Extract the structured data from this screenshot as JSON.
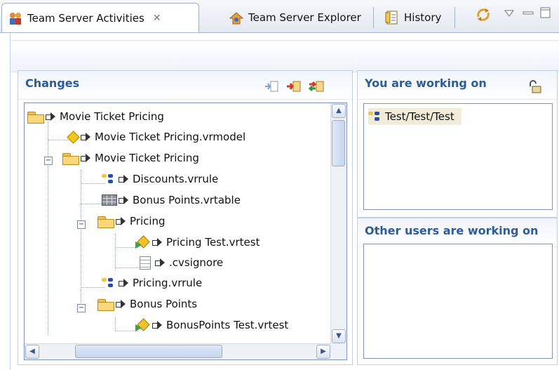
{
  "tabs": [
    {
      "label": "Team Server Activities",
      "close": "✕",
      "icon": "team-activities-icon"
    },
    {
      "label": "Team Server Explorer",
      "icon": "team-explorer-icon"
    },
    {
      "label": "History",
      "icon": "history-icon"
    }
  ],
  "toolbar_icons": [
    "sync-icon",
    "view-menu-icon",
    "minimize-icon",
    "maximize-icon"
  ],
  "changes": {
    "title": "Changes",
    "actions": [
      "incoming-icon",
      "outgoing-icon",
      "conflict-icon"
    ],
    "tree": [
      {
        "label": "Movie Ticket Pricing",
        "icon": "folder-icon"
      },
      {
        "label": "Movie Ticket Pricing.vrmodel",
        "icon": "model-icon"
      },
      {
        "label": "Movie Ticket Pricing",
        "icon": "folder-icon"
      },
      {
        "label": "Discounts.vrrule",
        "icon": "rule-icon"
      },
      {
        "label": "Bonus Points.vrtable",
        "icon": "table-icon"
      },
      {
        "label": "Pricing",
        "icon": "folder-icon"
      },
      {
        "label": "Pricing Test.vrtest",
        "icon": "test-icon"
      },
      {
        "label": ".cvsignore",
        "icon": "document-icon"
      },
      {
        "label": "Pricing.vrrule",
        "icon": "rule-icon"
      },
      {
        "label": "Bonus Points",
        "icon": "folder-icon"
      },
      {
        "label": "BonusPoints Test.vrtest",
        "icon": "test-icon"
      }
    ]
  },
  "working_on": {
    "title": "You are working on",
    "action": "unlock-icon",
    "items": [
      {
        "label": "Test/Test/Test",
        "icon": "rule-icon"
      }
    ]
  },
  "others": {
    "title": "Other users are working on"
  }
}
